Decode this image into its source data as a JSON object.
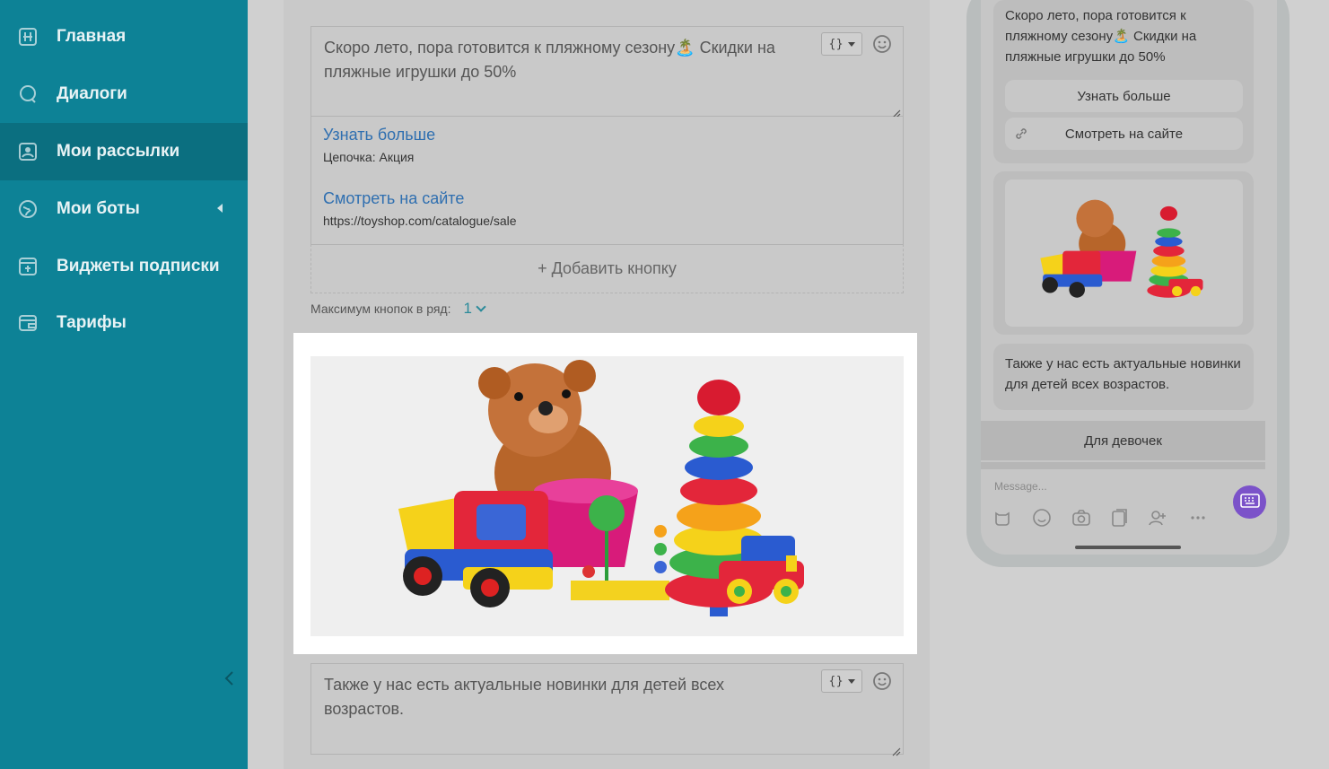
{
  "sidebar": {
    "items": [
      {
        "label": "Главная",
        "icon": "home-icon"
      },
      {
        "label": "Диалоги",
        "icon": "chat-icon"
      },
      {
        "label": "Мои рассылки",
        "icon": "mailing-icon"
      },
      {
        "label": "Мои боты",
        "icon": "bot-icon"
      },
      {
        "label": "Виджеты подписки",
        "icon": "widget-icon"
      },
      {
        "label": "Тарифы",
        "icon": "wallet-icon"
      }
    ],
    "active_index": 2
  },
  "editor": {
    "message1": "Скоро лето, пора готовится к пляжному сезону🏝️ Скидки на пляжные игрушки до 50%",
    "buttons": [
      {
        "title": "Узнать больше",
        "sub": "Цепочка: Акция"
      },
      {
        "title": "Смотреть на сайте",
        "sub": "https://toyshop.com/catalogue/sale"
      }
    ],
    "add_button": "+ Добавить кнопку",
    "max_buttons_label": "Максимум кнопок в ряд:",
    "max_buttons_value": "1",
    "variables_label": "{}",
    "message2": "Также у нас есть актуальные новинки для детей всех возрастов."
  },
  "preview": {
    "message1": "Скоро лето, пора готовится к пляжному сезону🏝️ Скидки на пляжные игрушки до 50%",
    "btn1": "Узнать больше",
    "btn2": "Смотреть на сайте",
    "message2": "Также у нас есть актуальные новинки для детей всех возрастов.",
    "keyboard_button": "Для девочек",
    "input_placeholder": "Message..."
  },
  "colors": {
    "sidebar": "#0d8296",
    "sidebar_active": "#0b6f80",
    "link": "#2f6fb0",
    "accent": "#7b52c9"
  }
}
